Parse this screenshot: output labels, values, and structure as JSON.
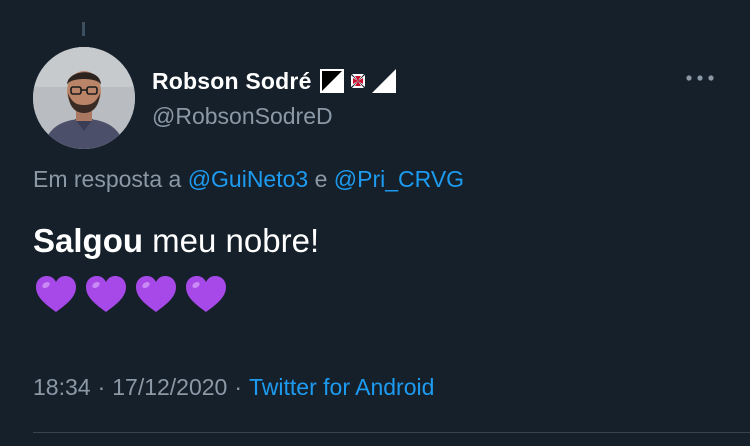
{
  "tweet": {
    "author": {
      "display_name": "Robson Sodré",
      "handle": "@RobsonSodreD",
      "name_emoji_icons": [
        "black-triangle-icon",
        "maltese-cross-icon",
        "white-triangle-icon"
      ]
    },
    "reply_context": {
      "prefix": "Em resposta a",
      "mention_1": "@GuiNeto3",
      "conjunction": "e",
      "mention_2": "@Pri_CRVG"
    },
    "text": {
      "bold_part": "Salgou",
      "rest": " meu nobre!",
      "emojis": [
        "purple-heart-icon",
        "purple-heart-icon",
        "purple-heart-icon",
        "purple-heart-icon"
      ]
    },
    "meta": {
      "time": "18:34",
      "separator": "·",
      "date": "17/12/2020",
      "source": "Twitter for Android"
    }
  },
  "colors": {
    "background": "#15202b",
    "text_primary": "#ffffff",
    "text_secondary": "#8b98a5",
    "link": "#1d9bf0",
    "heart": "#a748e8"
  }
}
